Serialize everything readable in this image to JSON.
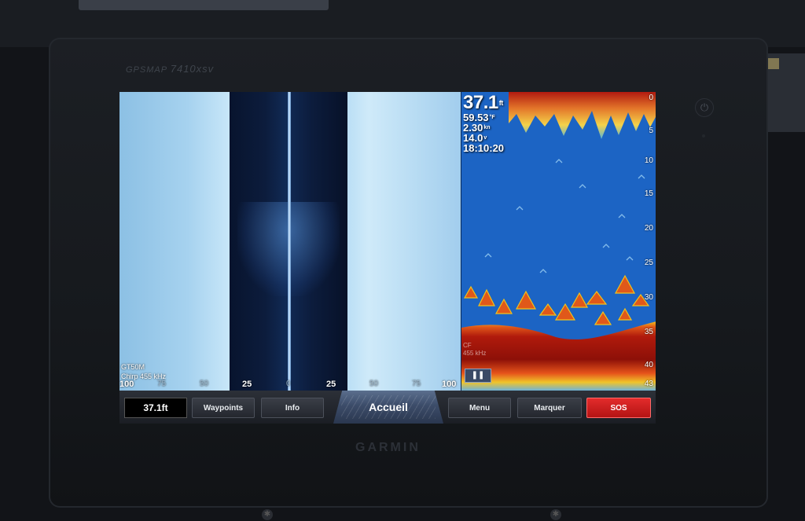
{
  "device": {
    "model_prefix": "GPSMAP",
    "model_number": "7410xsv",
    "brand": "GARMIN",
    "power_icon": "power-icon"
  },
  "sidevu": {
    "transducer": "GT50M",
    "frequency": "Chirp 455 kHz",
    "scale_labels": [
      "100",
      "75",
      "50",
      "25",
      "0",
      "25",
      "50",
      "75",
      "100"
    ]
  },
  "traditional": {
    "depth": "37.1",
    "depth_unit": "ft",
    "temperature": "59.53",
    "temperature_unit": "°F",
    "speed": "2.30",
    "speed_unit": "kn",
    "voltage": "14.0",
    "voltage_unit": "v",
    "time": "18:10:20",
    "depth_scale": [
      "0",
      "5",
      "10",
      "15",
      "20",
      "25",
      "30",
      "35",
      "40",
      "43"
    ],
    "freq_label_line1": "CF",
    "freq_label_line2": "455 kHz",
    "pause_icon": "pause-icon"
  },
  "button_bar": {
    "depth_readout": "37.1ft",
    "waypoints_label": "Waypoints",
    "info_label": "Info",
    "home_label": "Accueil",
    "menu_label": "Menu",
    "mark_label": "Marquer",
    "sos_label": "SOS"
  },
  "colors": {
    "sonar_water": "#1c64c4",
    "sidevu_bright": "#c7e6f8",
    "sos": "#c81d1d",
    "bottom_red": "#b01a0c",
    "bottom_yellow": "#f2c21a"
  }
}
